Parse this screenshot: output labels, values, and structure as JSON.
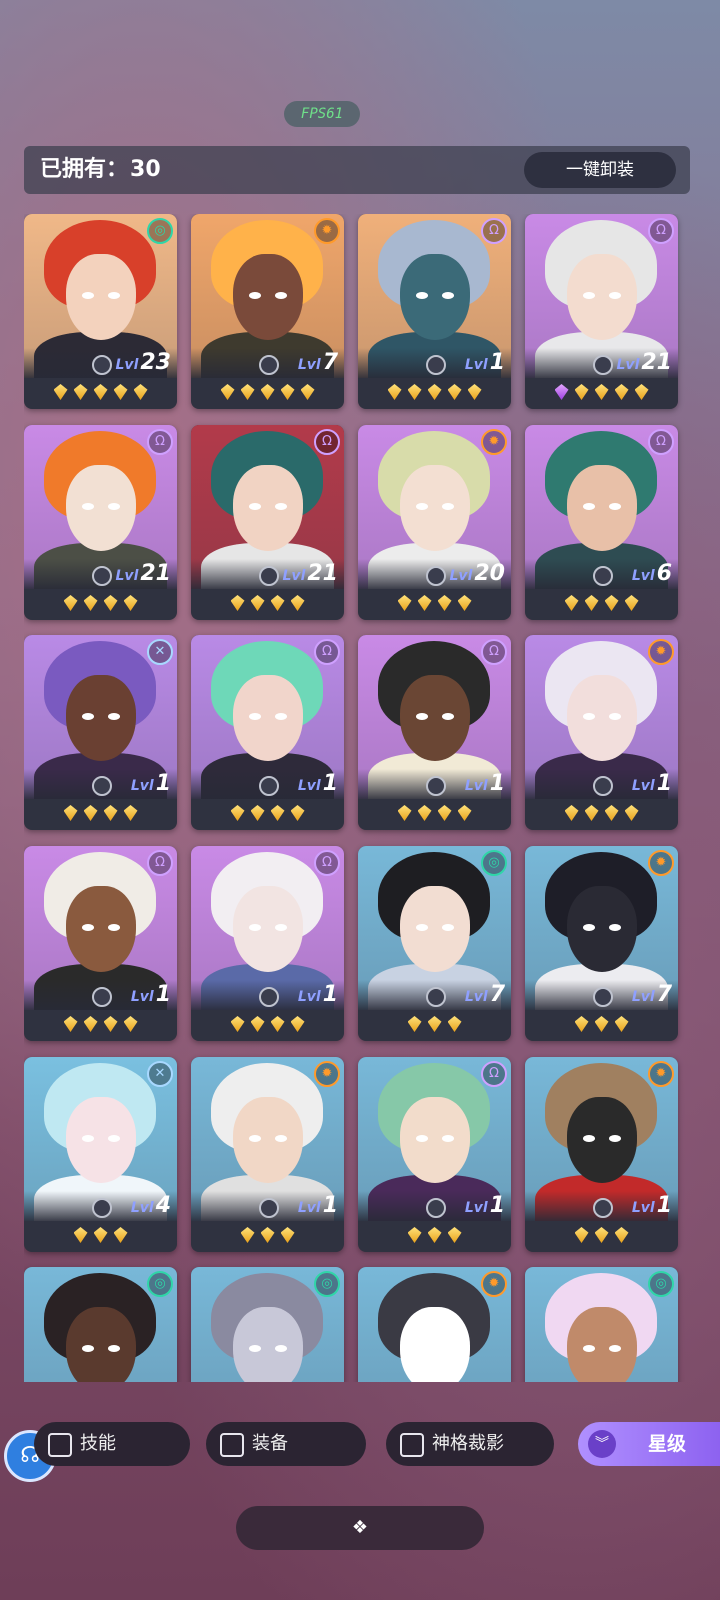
{
  "fps": "FPS61",
  "header": {
    "owned_label": "已拥有：",
    "owned_count": "30",
    "unequip_label": "一键卸装"
  },
  "cards": [
    {
      "level": "23",
      "badge": "◎",
      "badge_color": "#2fd6a8",
      "gems": 5,
      "purple": 0,
      "bg": "#f0b888",
      "hair": "#d8402a",
      "skin": "#f3d2bd",
      "body": "#2c2a35"
    },
    {
      "level": "7",
      "badge": "✹",
      "badge_color": "#ff9a2a",
      "gems": 5,
      "purple": 0,
      "bg": "#f0a66a",
      "hair": "#ffb24a",
      "skin": "#7a4a3a",
      "body": "#3e3a2e"
    },
    {
      "level": "1",
      "badge": "Ω",
      "badge_color": "#cfa0ff",
      "gems": 5,
      "purple": 0,
      "bg": "#f0b07a",
      "hair": "#a8b8d0",
      "skin": "#3b6a78",
      "body": "#2f5666"
    },
    {
      "level": "21",
      "badge": "Ω",
      "badge_color": "#cfa0ff",
      "gems": 4,
      "purple": 1,
      "bg": "#c98ae6",
      "hair": "#e6e6e6",
      "skin": "#f3dccf",
      "body": "#e8e8ea"
    },
    {
      "level": "21",
      "badge": "Ω",
      "badge_color": "#cfa0ff",
      "gems": 4,
      "purple": 0,
      "bg": "#c98ae6",
      "hair": "#f07a2a",
      "skin": "#f2e0d3",
      "body": "#4c4f46"
    },
    {
      "level": "21",
      "badge": "Ω",
      "badge_color": "#cfa0ff",
      "gems": 4,
      "purple": 0,
      "bg": "#b23a4a",
      "hair": "#2a6a6a",
      "skin": "#f1d3c3",
      "body": "#e6e6e6"
    },
    {
      "level": "20",
      "badge": "✹",
      "badge_color": "#ff9a2a",
      "gems": 4,
      "purple": 0,
      "bg": "#c98ae6",
      "hair": "#d8dcaa",
      "skin": "#f3dfd2",
      "body": "#ececec"
    },
    {
      "level": "6",
      "badge": "Ω",
      "badge_color": "#cfa0ff",
      "gems": 4,
      "purple": 0,
      "bg": "#c98ae6",
      "hair": "#2f7a70",
      "skin": "#e8c0a8",
      "body": "#2e4c52"
    },
    {
      "level": "1",
      "badge": "✕",
      "badge_color": "#a8d8ff",
      "gems": 4,
      "purple": 0,
      "bg": "#b98ae6",
      "hair": "#7a5ac0",
      "skin": "#6a4032",
      "body": "#3a2a4a"
    },
    {
      "level": "1",
      "badge": "Ω",
      "badge_color": "#cfa0ff",
      "gems": 4,
      "purple": 0,
      "bg": "#b98ae6",
      "hair": "#6ed8b8",
      "skin": "#f1d5cb",
      "body": "#2e2a3a"
    },
    {
      "level": "1",
      "badge": "Ω",
      "badge_color": "#cfa0ff",
      "gems": 4,
      "purple": 0,
      "bg": "#c98ae6",
      "hair": "#2a2a2a",
      "skin": "#6a4634",
      "body": "#f1ead6"
    },
    {
      "level": "1",
      "badge": "✹",
      "badge_color": "#ff9a2a",
      "gems": 4,
      "purple": 0,
      "bg": "#b98ae6",
      "hair": "#ebe6f2",
      "skin": "#f2dedc",
      "body": "#3a2a4a"
    },
    {
      "level": "1",
      "badge": "Ω",
      "badge_color": "#cfa0ff",
      "gems": 4,
      "purple": 0,
      "bg": "#c98ae6",
      "hair": "#f0ece6",
      "skin": "#8a5a3e",
      "body": "#2a2a2a"
    },
    {
      "level": "1",
      "badge": "Ω",
      "badge_color": "#cfa0ff",
      "gems": 4,
      "purple": 0,
      "bg": "#c98ae6",
      "hair": "#f2eef2",
      "skin": "#f2e4e2",
      "body": "#5a6aa8"
    },
    {
      "level": "7",
      "badge": "◎",
      "badge_color": "#2fd6a8",
      "gems": 3,
      "purple": 0,
      "bg": "#78b8d8",
      "hair": "#1e1e22",
      "skin": "#f2ddd2",
      "body": "#c8d2e2"
    },
    {
      "level": "7",
      "badge": "✹",
      "badge_color": "#ff9a2a",
      "gems": 3,
      "purple": 0,
      "bg": "#78b8d8",
      "hair": "#1e1e28",
      "skin": "#2a2a34",
      "body": "#ececf0"
    },
    {
      "level": "4",
      "badge": "✕",
      "badge_color": "#a8d8ff",
      "gems": 3,
      "purple": 0,
      "bg": "#7ac0e0",
      "hair": "#bfe8f2",
      "skin": "#f6e2e6",
      "body": "#f0f6fa"
    },
    {
      "level": "1",
      "badge": "✹",
      "badge_color": "#ff9a2a",
      "gems": 3,
      "purple": 0,
      "bg": "#78b8d8",
      "hair": "#eeeeee",
      "skin": "#f1d7c6",
      "body": "#e0e0e0"
    },
    {
      "level": "1",
      "badge": "Ω",
      "badge_color": "#cfa0ff",
      "gems": 3,
      "purple": 0,
      "bg": "#78b8d8",
      "hair": "#86c8a8",
      "skin": "#f2dccb",
      "body": "#4a2a5a"
    },
    {
      "level": "1",
      "badge": "✹",
      "badge_color": "#ff9a2a",
      "gems": 3,
      "purple": 0,
      "bg": "#78b8d8",
      "hair": "#a08060",
      "skin": "#2a2a2a",
      "body": "#c22a2a"
    },
    {
      "level": "",
      "badge": "◎",
      "badge_color": "#2fd6a8",
      "gems": 0,
      "purple": 0,
      "bg": "#78b8d8",
      "hair": "#2a2224",
      "skin": "#5a3a2e",
      "body": "#3a2a2a"
    },
    {
      "level": "",
      "badge": "◎",
      "badge_color": "#2fd6a8",
      "gems": 0,
      "purple": 0,
      "bg": "#78b8d8",
      "hair": "#8a8aa0",
      "skin": "#c8c8d8",
      "body": "#4a4a5a"
    },
    {
      "level": "",
      "badge": "✹",
      "badge_color": "#ff9a2a",
      "gems": 0,
      "purple": 0,
      "bg": "#78b8d8",
      "hair": "#3a3a44",
      "skin": "#ffffff",
      "body": "#3a3a44"
    },
    {
      "level": "",
      "badge": "◎",
      "badge_color": "#2fd6a8",
      "gems": 0,
      "purple": 0,
      "bg": "#78b8d8",
      "hair": "#f0d8f2",
      "skin": "#c08a6a",
      "body": "#2a2a34"
    }
  ],
  "level_prefix": "Lvl",
  "filters": {
    "skill": "技能",
    "equip": "装备",
    "shadow": "神格裁影"
  },
  "sort": {
    "label": "星级",
    "icon": "chevrons-down-icon"
  },
  "avatar_icon": "headset-icon",
  "bottom_icon": "diamond-cluster-icon"
}
